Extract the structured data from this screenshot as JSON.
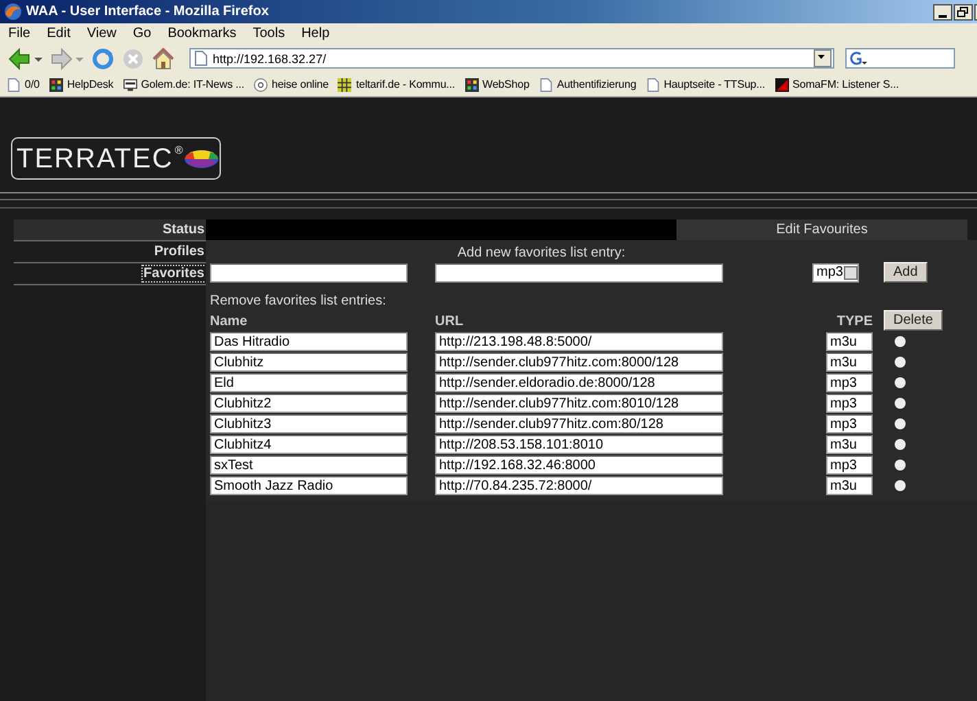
{
  "window": {
    "title": "WAA - User Interface - Mozilla Firefox"
  },
  "menu": [
    "File",
    "Edit",
    "View",
    "Go",
    "Bookmarks",
    "Tools",
    "Help"
  ],
  "address": {
    "value": "http://192.168.32.27/"
  },
  "bookmarks": [
    {
      "label": "0/0",
      "kind": "page"
    },
    {
      "label": "HelpDesk",
      "kind": "app"
    },
    {
      "label": "Golem.de: IT-News ...",
      "kind": "screen"
    },
    {
      "label": "heise online",
      "kind": "at"
    },
    {
      "label": "teltarif.de - Kommu...",
      "kind": "grid"
    },
    {
      "label": "WebShop",
      "kind": "app"
    },
    {
      "label": "Authentifizierung",
      "kind": "page"
    },
    {
      "label": "Hauptseite - TTSup...",
      "kind": "page"
    },
    {
      "label": "SomaFM: Listener S...",
      "kind": "red"
    }
  ],
  "logo": {
    "text": "TERRATEC",
    "mark": "®"
  },
  "nav": [
    {
      "label": "Status",
      "selected": false
    },
    {
      "label": "Profiles",
      "selected": false
    },
    {
      "label": "Favorites",
      "selected": true
    }
  ],
  "section_title": "Edit Favourites",
  "add": {
    "label": "Add new favorites list entry:",
    "type": "mp3",
    "button": "Add"
  },
  "remove_label": "Remove favorites list entries:",
  "columns": [
    "Name",
    "URL",
    "TYPE"
  ],
  "delete_button": "Delete",
  "entries": [
    {
      "name": "Das Hitradio",
      "url": "http://213.198.48.8:5000/",
      "type": "m3u",
      "selected": false
    },
    {
      "name": "Clubhitz",
      "url": "http://sender.club977hitz.com:8000/128",
      "type": "m3u",
      "selected": false
    },
    {
      "name": "Eld",
      "url": "http://sender.eldoradio.de:8000/128",
      "type": "mp3",
      "selected": false
    },
    {
      "name": "Clubhitz2",
      "url": "http://sender.club977hitz.com:8010/128",
      "type": "mp3",
      "selected": false
    },
    {
      "name": "Clubhitz3",
      "url": "http://sender.club977hitz.com:80/128",
      "type": "mp3",
      "selected": false
    },
    {
      "name": "Clubhitz4",
      "url": "http://208.53.158.101:8010",
      "type": "m3u",
      "selected": false
    },
    {
      "name": "sxTest",
      "url": "http://192.168.32.46:8000",
      "type": "mp3",
      "selected": false
    },
    {
      "name": "Smooth Jazz Radio",
      "url": "http://70.84.235.72:8000/",
      "type": "m3u",
      "selected": false
    }
  ]
}
